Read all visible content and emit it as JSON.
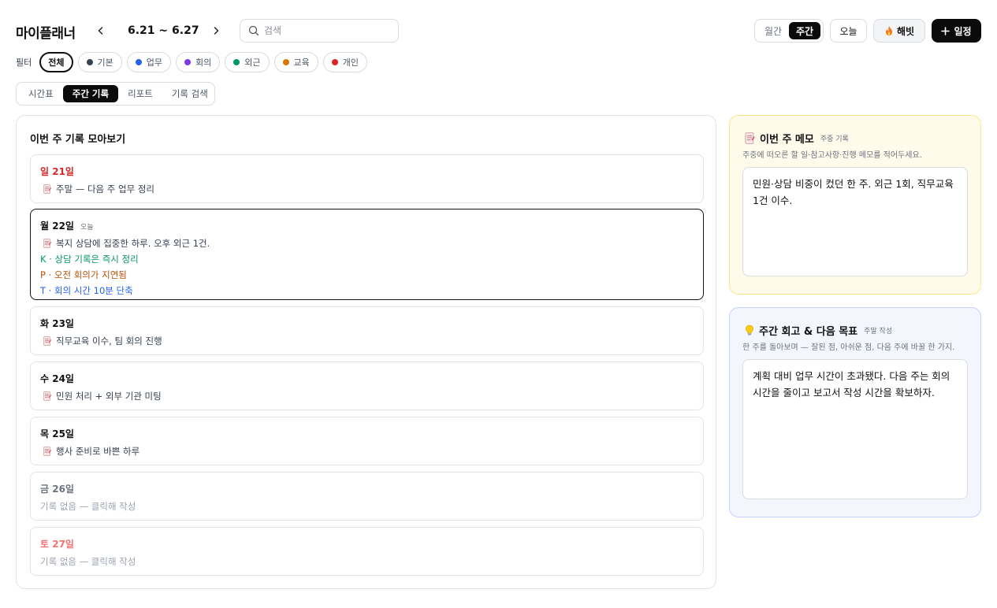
{
  "header": {
    "app_title": "마이플래너",
    "date_range": "6.21 ~ 6.27",
    "search_placeholder": "검색",
    "view_toggle": {
      "month_label": "월간",
      "week_label": "주간",
      "active": "주간"
    },
    "today_label": "오늘",
    "habit_label": "해빗",
    "add_label": "일정"
  },
  "filters": {
    "label": "필터",
    "chips": [
      {
        "label": "전체",
        "active": true
      },
      {
        "label": "기본",
        "color": "#374151"
      },
      {
        "label": "업무",
        "color": "#2563eb"
      },
      {
        "label": "회의",
        "color": "#7c3aed"
      },
      {
        "label": "외근",
        "color": "#059669"
      },
      {
        "label": "교육",
        "color": "#d97706"
      },
      {
        "label": "개인",
        "color": "#dc2626"
      }
    ]
  },
  "tabs": {
    "items": [
      "시간표",
      "주간 기록",
      "리포트",
      "기록 검색"
    ],
    "active": "주간 기록"
  },
  "weekly": {
    "title": "이번 주 기록 모아보기",
    "days": [
      {
        "label": "일 21일",
        "memo": "주말 — 다음 주 업무 정리"
      },
      {
        "label": "월 22일",
        "badge": "오늘",
        "memo": "복지 상담에 집중한 하루. 오후 외근 1건.",
        "k": "K · 상담 기록은 즉시 정리",
        "p": "P · 오전 회의가 지연됨",
        "t": "T · 회의 시간 10분 단축"
      },
      {
        "label": "화 23일",
        "memo": "직무교육 이수, 팀 회의 진행"
      },
      {
        "label": "수 24일",
        "memo": "민원 처리 + 외부 기관 미팅"
      },
      {
        "label": "목 25일",
        "memo": "행사 준비로 바쁜 하루"
      },
      {
        "label": "금 26일",
        "empty": "기록 없음 — 클릭해 작성"
      },
      {
        "label": "토 27일",
        "empty": "기록 없음 — 클릭해 작성"
      }
    ]
  },
  "memo": {
    "title": "이번 주 메모",
    "tag": "주중 기록",
    "desc": "주중에 떠오른 할 일·참고사항·진행 메모를 적어두세요.",
    "content": "민원·상담 비중이 컸던 한 주. 외근 1회, 직무교육 1건 이수."
  },
  "retro": {
    "title": "주간 회고 & 다음 목표",
    "tag": "주말 작성",
    "desc": "한 주를 돌아보며 — 잘된 점, 아쉬운 점, 다음 주에 바꿀 한 가지.",
    "content": "계획 대비 업무 시간이 초과됐다. 다음 주는 회의 시간을 줄이고 보고서 작성 시간을 확보하자."
  },
  "colors": {
    "accent": "#0b0b0b",
    "sunday": "#dc2626",
    "saturday": "#f87171",
    "keep": "#059669",
    "problem": "#b45309",
    "try": "#2563eb",
    "memo_bg": "#fffbeb",
    "retro_bg": "#f3f6fd"
  }
}
